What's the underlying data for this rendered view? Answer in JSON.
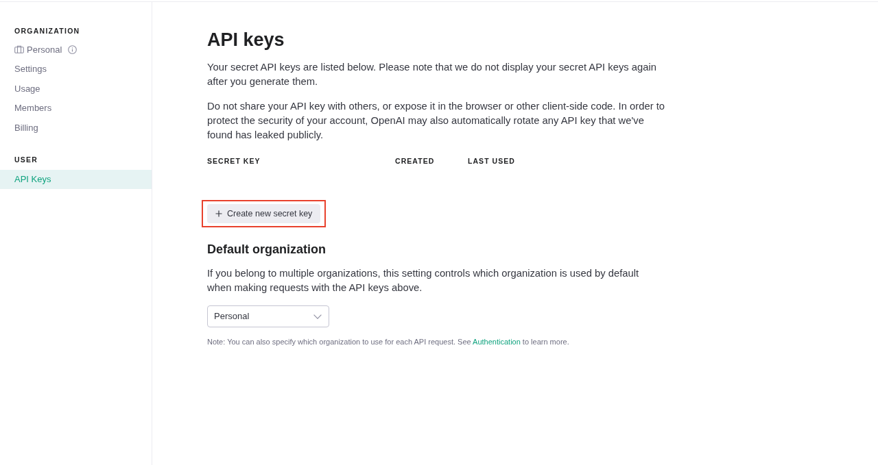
{
  "sidebar": {
    "sections": [
      {
        "heading": "ORGANIZATION",
        "items": [
          {
            "label": "Personal",
            "kind": "org",
            "selected": false
          },
          {
            "label": "Settings",
            "kind": "link",
            "selected": false
          },
          {
            "label": "Usage",
            "kind": "link",
            "selected": false
          },
          {
            "label": "Members",
            "kind": "link",
            "selected": false
          },
          {
            "label": "Billing",
            "kind": "link",
            "selected": false
          }
        ]
      },
      {
        "heading": "USER",
        "items": [
          {
            "label": "API Keys",
            "kind": "link",
            "selected": true
          }
        ]
      }
    ]
  },
  "main": {
    "title": "API keys",
    "paragraphs": [
      "Your secret API keys are listed below. Please note that we do not display your secret API keys again after you generate them.",
      "Do not share your API key with others, or expose it in the browser or other client-side code. In order to protect the security of your account, OpenAI may also automatically rotate any API key that we've found has leaked publicly."
    ],
    "table": {
      "columns": [
        "SECRET KEY",
        "CREATED",
        "LAST USED"
      ]
    },
    "create_button": {
      "label": "Create new secret key",
      "highlighted": true
    },
    "default_organization": {
      "heading": "Default organization",
      "description": "If you belong to multiple organizations, this setting controls which organization is used by default when making requests with the API keys above.",
      "select": {
        "value": "Personal"
      },
      "note": {
        "text_before": "Note: You can also specify which organization to use for each API request. See",
        "link": "Authentication",
        "text_after": "to learn more."
      }
    }
  }
}
